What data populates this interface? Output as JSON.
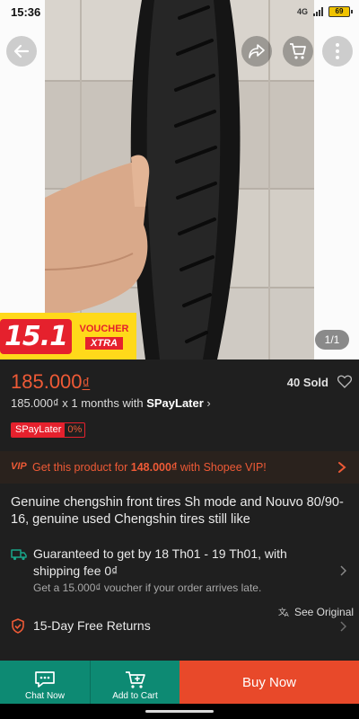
{
  "status_bar": {
    "time": "15:36",
    "signal_label": "4G",
    "battery": "69"
  },
  "gallery": {
    "counter": "1/1"
  },
  "promo": {
    "number": "15.1",
    "voucher": "VOUCHER",
    "xtra": "XTRA"
  },
  "product": {
    "price": "185.000",
    "currency": "₫",
    "sold": "40 Sold",
    "installment_prefix": "185.000₫ x 1 months with ",
    "installment_brand": "SPayLater",
    "spaylater_badge": "SPayLater",
    "spaylater_rate": "0%",
    "title": "Genuine chengshin front tires Sh mode and Nouvo 80/90-16, genuine used Chengshin tires still like"
  },
  "vip": {
    "tag": "VIP",
    "text_prefix": "Get this product for ",
    "price": "148.000₫",
    "text_suffix": " with Shopee VIP!"
  },
  "shipping": {
    "main": "Guaranteed to get by 18 Th01 - 19 Th01, with shipping fee 0₫",
    "sub": "Get a 15.000₫ voucher if your order arrives late."
  },
  "see_original": "See Original",
  "returns": {
    "text": "15-Day Free Returns"
  },
  "bottom_bar": {
    "chat": "Chat Now",
    "cart": "Add to Cart",
    "buy": "Buy Now"
  },
  "colors": {
    "accent": "#ee5a36",
    "teal": "#0d8a73",
    "buy": "#e8492a",
    "background": "#1f1f1f"
  }
}
